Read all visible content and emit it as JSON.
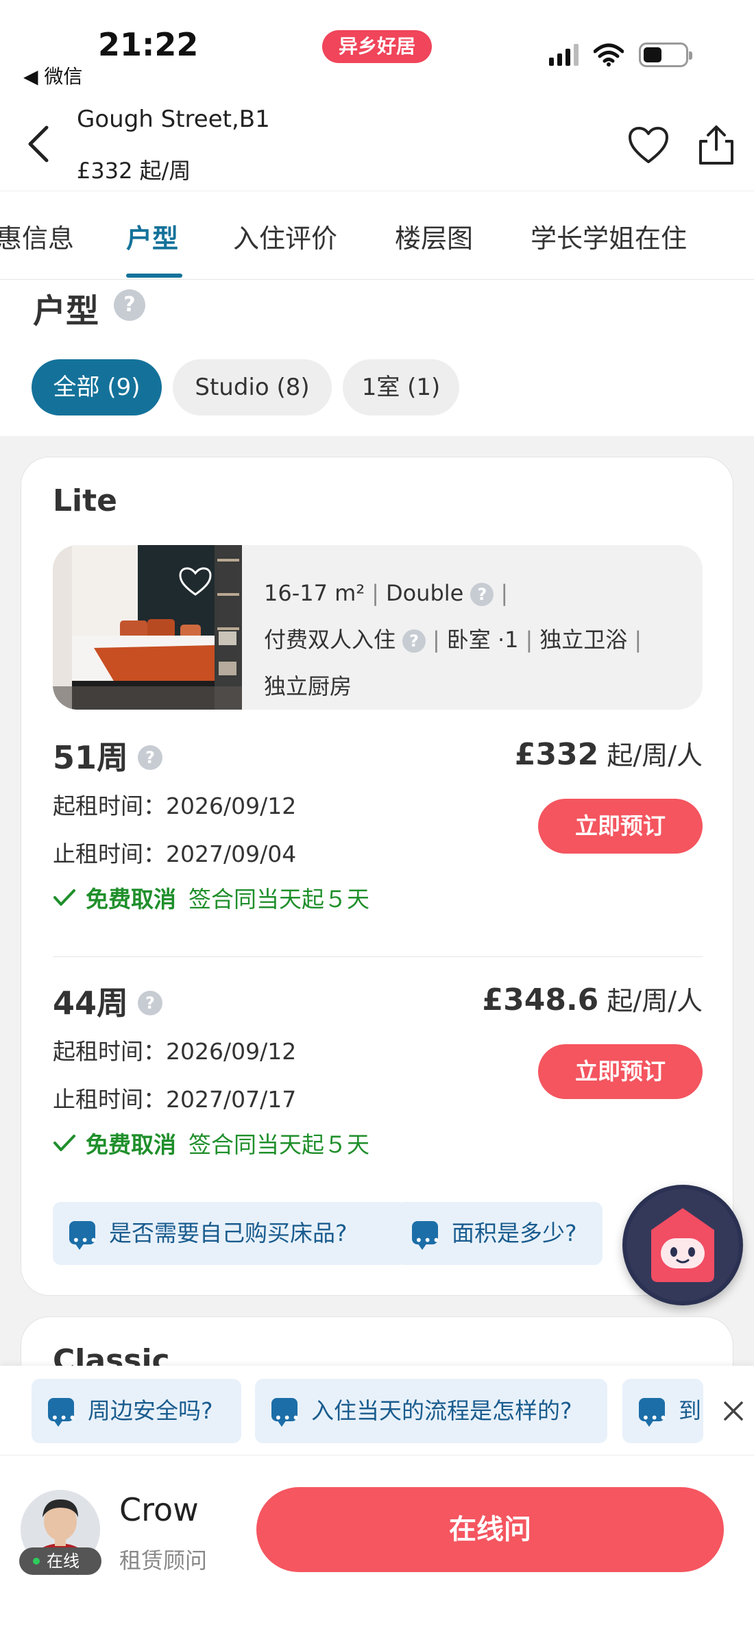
{
  "status_bar": {
    "time": "21:22",
    "back_app": "◀ 微信",
    "brand": "异乡好居"
  },
  "header": {
    "property_name": "Gough Street,B1",
    "price": "£332 起/周"
  },
  "tabs": [
    {
      "label": "惠信息",
      "active": false
    },
    {
      "label": "户型",
      "active": true
    },
    {
      "label": "入住评价",
      "active": false
    },
    {
      "label": "楼层图",
      "active": false
    },
    {
      "label": "学长学姐在住",
      "active": false
    }
  ],
  "section": {
    "title": "户型",
    "help": "?"
  },
  "filters": [
    {
      "label": "全部 (9)",
      "active": true
    },
    {
      "label": "Studio (8)",
      "active": false
    },
    {
      "label": "1室 (1)",
      "active": false
    }
  ],
  "room_card": {
    "title": "Lite",
    "area": "16-17 m²",
    "bed": "Double",
    "occupancy": "付费双人入住",
    "bedroom": "卧室 ·1",
    "bathroom": "独立卫浴",
    "kitchen": "独立厨房",
    "separator": "|",
    "plans": [
      {
        "weeks": "51周",
        "price_value": "£332",
        "price_unit": "起/周/人",
        "start": "起租时间：2026/09/12",
        "end": "止租时间：2027/09/04",
        "book_label": "立即预订",
        "cancel_label": "免费取消",
        "cancel_note": "签合同当天起５天"
      },
      {
        "weeks": "44周",
        "price_value": "£348.6",
        "price_unit": "起/周/人",
        "start": "起租时间：2026/09/12",
        "end": "止租时间：2027/07/17",
        "book_label": "立即预订",
        "cancel_label": "免费取消",
        "cancel_note": "签合同当天起５天"
      }
    ],
    "questions": [
      "是否需要自己购买床品?",
      "面积是多少?"
    ]
  },
  "next_card": {
    "title": "Classic"
  },
  "quick_questions": [
    "周边安全吗?",
    "入住当天的流程是怎样的?",
    "到"
  ],
  "agent": {
    "name": "Crow",
    "role": "租赁顾问",
    "status": "在线"
  },
  "ask_button": "在线问",
  "colors": {
    "primary": "#14729a",
    "accent_red": "#f4555f",
    "success_green": "#1f8f2b",
    "chip_bg": "#e8f1fa"
  }
}
